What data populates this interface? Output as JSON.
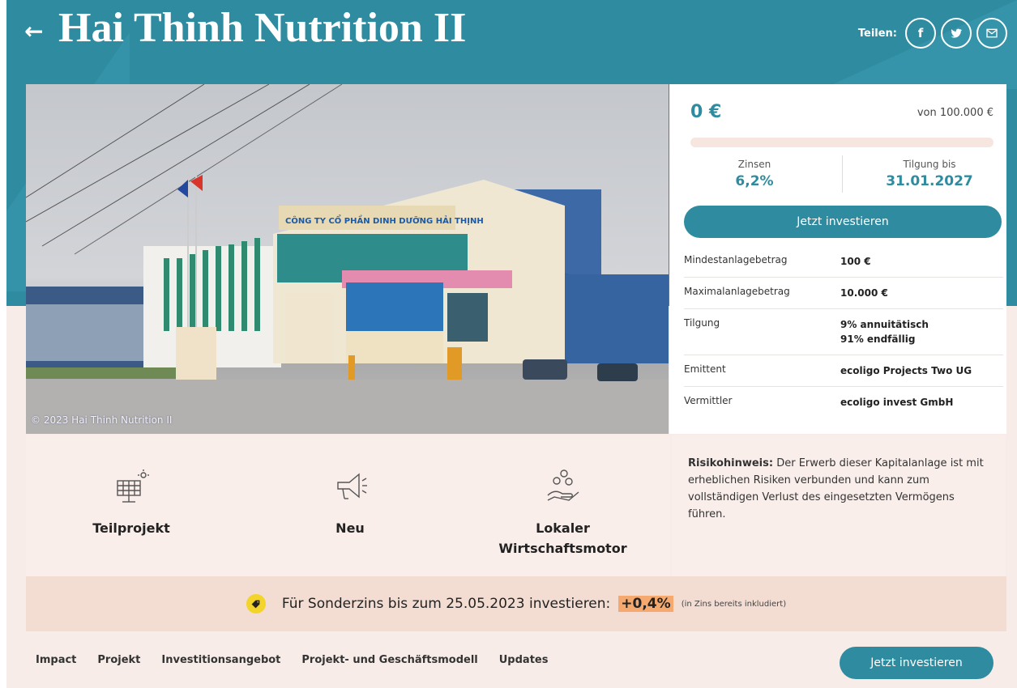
{
  "header": {
    "back_icon": "arrow-left-icon",
    "title": "Hai Thinh Nutrition II",
    "share_label": "Teilen:",
    "share_buttons": [
      {
        "icon": "facebook-icon",
        "glyph": "f"
      },
      {
        "icon": "twitter-icon"
      },
      {
        "icon": "mail-icon"
      }
    ]
  },
  "photo": {
    "credit": "© 2023 Hai Thinh Nutrition II",
    "sign_text": "CÔNG TY CỔ PHẦN DINH DƯỠNG HẢI THỊNH"
  },
  "investment": {
    "raised": "0 €",
    "goal": "von 100.000 €",
    "progress_fraction": 0.0,
    "interest_label": "Zinsen",
    "interest_value": "6,2%",
    "repayment_label": "Tilgung bis",
    "repayment_value": "31.01.2027",
    "cta": "Jetzt investieren",
    "details": [
      {
        "key": "Mindestanlagebetrag",
        "value": "100 €"
      },
      {
        "key": "Maximalanlagebetrag",
        "value": "10.000 €"
      },
      {
        "key": "Tilgung",
        "value": "9% annuitätisch",
        "value2": "91% endfällig"
      },
      {
        "key": "Emittent",
        "value": "ecoligo Projects Two UG"
      },
      {
        "key": "Vermittler",
        "value": "ecoligo invest GmbH"
      }
    ]
  },
  "features": [
    {
      "icon": "solar-panel-icon",
      "label": "Teilprojekt"
    },
    {
      "icon": "megaphone-icon",
      "label": "Neu"
    },
    {
      "icon": "coins-hand-icon",
      "label": "Lokaler",
      "label2": "Wirtschaftsmotor"
    }
  ],
  "risk": {
    "title": "Risikohinweis:",
    "text": " Der Erwerb dieser Kapitalanlage ist mit erheblichen Risiken verbunden und kann zum vollständigen Verlust des eingesetzten Vermögens führen."
  },
  "banner": {
    "icon": "price-tag-icon",
    "text": "Für Sonderzins bis zum 25.05.2023 investieren:",
    "bonus": "+0,4%",
    "note": "(in Zins bereits inkludiert)"
  },
  "nav": {
    "items": [
      "Impact",
      "Projekt",
      "Investitionsangebot",
      "Projekt- und Geschäftsmodell",
      "Updates"
    ],
    "cta": "Jetzt investieren"
  },
  "colors": {
    "teal": "#2e8ba0",
    "background": "#f7ece7",
    "bonus_highlight": "#f5a96e",
    "tag_yellow": "#f2d42a"
  }
}
